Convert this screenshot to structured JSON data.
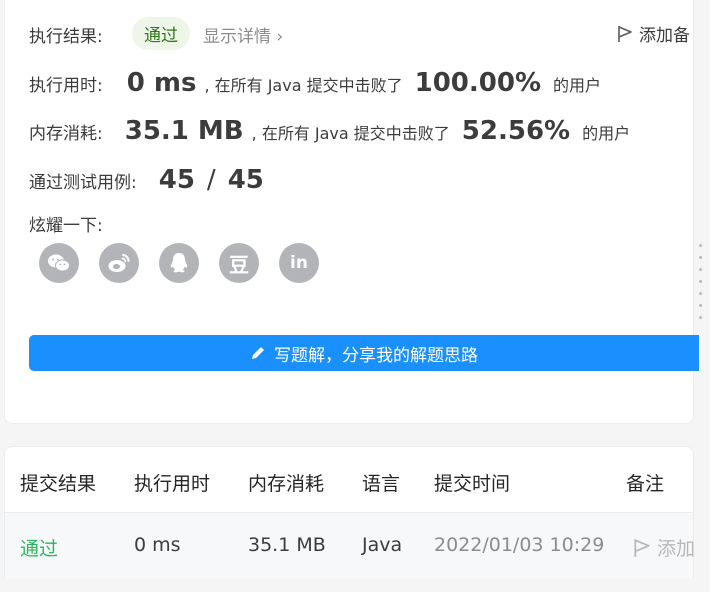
{
  "result": {
    "label": "执行结果:",
    "status": "通过",
    "details": "显示详情 ›",
    "add_note": "添加备"
  },
  "runtime": {
    "label": "执行用时:",
    "value": "0 ms",
    "mid": ", 在所有 Java 提交中击败了",
    "percent": "100.00%",
    "suffix": "的用户"
  },
  "memory": {
    "label": "内存消耗:",
    "value": "35.1 MB",
    "mid": ", 在所有 Java 提交中击败了",
    "percent": "52.56%",
    "suffix": "的用户"
  },
  "tests": {
    "label": "通过测试用例:",
    "passed": "45",
    "sep": "/",
    "total": "45"
  },
  "share": {
    "label": "炫耀一下:",
    "icons": [
      "wechat-icon",
      "weibo-icon",
      "qq-icon",
      "douban-icon",
      "linkedin-icon"
    ],
    "douban_text": "豆",
    "linkedin_text": "in"
  },
  "write_button": "写题解，分享我的解题思路",
  "table": {
    "headers": [
      "提交结果",
      "执行用时",
      "内存消耗",
      "语言",
      "提交时间",
      "备注"
    ],
    "row": {
      "status": "通过",
      "runtime": "0 ms",
      "memory": "35.1 MB",
      "language": "Java",
      "time": "2022/01/03 10:29",
      "note": "添加"
    }
  },
  "colors": {
    "accent": "#1a90ff",
    "success": "#2db55d"
  }
}
